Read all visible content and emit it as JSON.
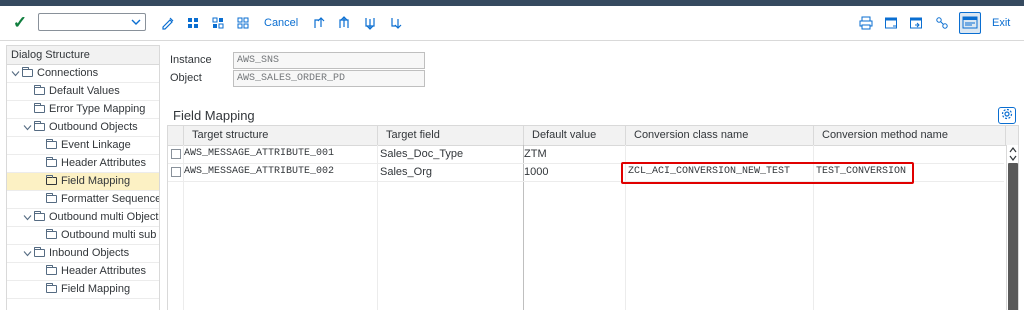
{
  "toolbar": {
    "command_value": "",
    "cancel_label": "Cancel",
    "exit_label": "Exit",
    "icons": [
      "check-icon",
      "edit-icon",
      "select-all-icon",
      "deselect-icon",
      "select-block-icon",
      "first-page-icon",
      "previous-page-icon",
      "next-page-icon",
      "last-page-icon",
      "print-icon",
      "new-window-icon",
      "export-window-icon",
      "hierarchy-icon",
      "gui-options-icon"
    ]
  },
  "dialog_structure": {
    "title": "Dialog Structure",
    "items": [
      {
        "label": "Connections",
        "level": 0,
        "expanded": true
      },
      {
        "label": "Default Values",
        "level": 1
      },
      {
        "label": "Error Type Mapping",
        "level": 1
      },
      {
        "label": "Outbound  Objects",
        "level": 1,
        "expanded": true
      },
      {
        "label": "Event Linkage",
        "level": 2
      },
      {
        "label": "Header Attributes",
        "level": 2
      },
      {
        "label": "Field Mapping",
        "level": 2,
        "selected": true
      },
      {
        "label": "Formatter Sequence",
        "level": 2
      },
      {
        "label": "Outbound multi Objects",
        "level": 1,
        "expanded": true
      },
      {
        "label": "Outbound multi sub Obj",
        "level": 2
      },
      {
        "label": "Inbound Objects",
        "level": 1,
        "expanded": true
      },
      {
        "label": "Header Attributes",
        "level": 2
      },
      {
        "label": "Field Mapping",
        "level": 2
      }
    ]
  },
  "fields": {
    "instance_label": "Instance",
    "instance_value": "AWS_SNS",
    "object_label": "Object",
    "object_value": "AWS_SALES_ORDER_PD"
  },
  "section_title": "Field Mapping",
  "table": {
    "columns": [
      "Target structure",
      "Target field",
      "Default value",
      "Conversion class name",
      "Conversion method name"
    ],
    "rows": [
      {
        "target_structure": "AWS_MESSAGE_ATTRIBUTE_001",
        "target_field": "Sales_Doc_Type",
        "default_value": "ZTM",
        "conversion_class": "",
        "conversion_method": ""
      },
      {
        "target_structure": "AWS_MESSAGE_ATTRIBUTE_002",
        "target_field": "Sales_Org",
        "default_value": "1000",
        "conversion_class": "ZCL_ACI_CONVERSION_NEW_TEST",
        "conversion_method": "TEST_CONVERSION"
      }
    ]
  },
  "colors": {
    "accent": "#0a6ed1",
    "highlight": "#e00000",
    "selected_row": "#fcf1c4",
    "shell": "#354a5f"
  }
}
